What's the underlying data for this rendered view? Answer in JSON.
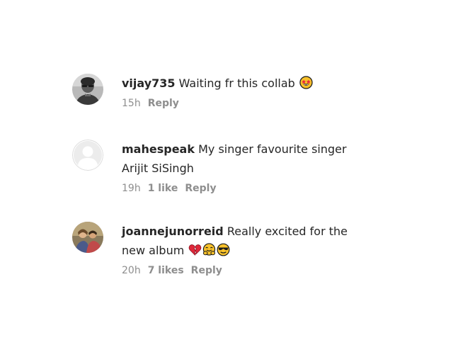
{
  "comments": [
    {
      "username": "vijay735",
      "text": "Waiting fr this collab",
      "emojis": [
        "star-struck-emoji"
      ],
      "time": "15h",
      "likes": "",
      "reply_label": "Reply"
    },
    {
      "username": "mahespeak",
      "text": "My singer favourite singer Arijit SiSingh",
      "emojis": [],
      "time": "19h",
      "likes": "1 like",
      "reply_label": "Reply"
    },
    {
      "username": "joannejunorreid",
      "text": "Really excited for the new album",
      "emojis": [
        "broken-heart-emoji",
        "hugging-face-emoji",
        "sunglasses-face-emoji"
      ],
      "time": "20h",
      "likes": "7 likes",
      "reply_label": "Reply"
    }
  ],
  "colors": {
    "text": "#262626",
    "secondary": "#8e8e8e",
    "background": "#ffffff"
  }
}
